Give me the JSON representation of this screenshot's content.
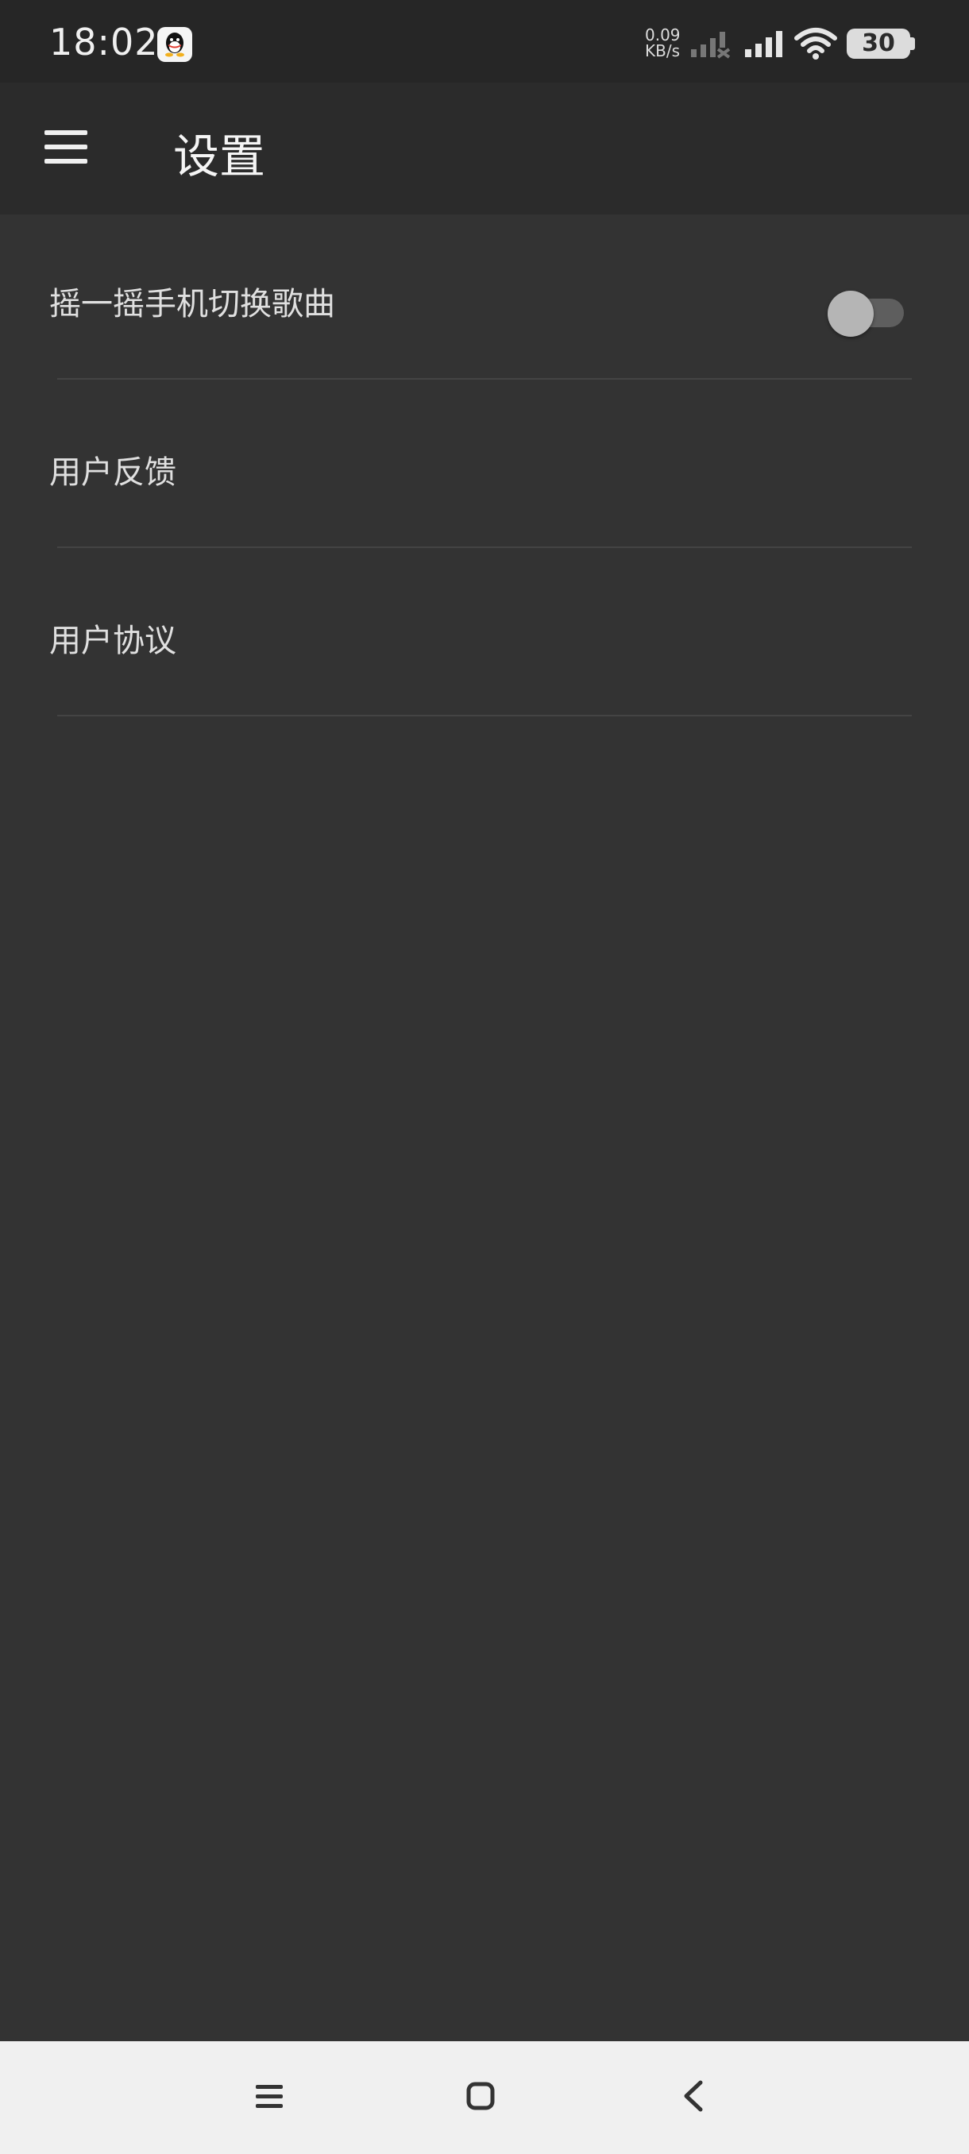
{
  "status_bar": {
    "time": "18:02",
    "net_speed_value": "0.09",
    "net_speed_unit": "KB/s",
    "battery": "30",
    "icons": [
      "qq-icon",
      "signal-icon",
      "signal-icon",
      "wifi-icon",
      "battery-icon"
    ]
  },
  "app_bar": {
    "title": "设置",
    "menu_icon": "hamburger-menu-icon"
  },
  "settings": {
    "items": [
      {
        "label": "摇一摇手机切换歌曲",
        "toggle": true,
        "toggle_on": false
      },
      {
        "label": "用户反馈"
      },
      {
        "label": "用户协议"
      }
    ]
  },
  "nav_bar": {
    "icons": [
      "recent-apps-icon",
      "home-icon",
      "back-icon"
    ]
  },
  "colors": {
    "background": "#333333",
    "app_bar": "#2b2b2b",
    "status_bar": "#262626",
    "nav_bar": "#f0f0f0",
    "text": "#e0e0e0"
  }
}
